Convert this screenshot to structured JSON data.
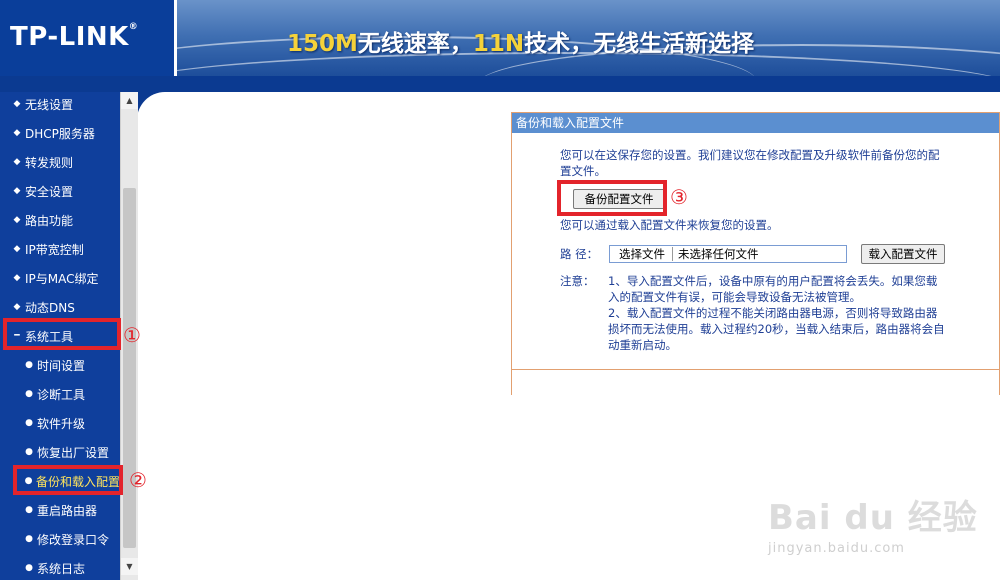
{
  "header": {
    "logo": "TP-LINK",
    "logo_mark": "®",
    "slogan_parts": [
      "150M",
      "无线速率，",
      "11N",
      "技术，无线生活新选择"
    ]
  },
  "sidebar": {
    "items": [
      {
        "label": "无线设置",
        "level": 1
      },
      {
        "label": "DHCP服务器",
        "level": 1
      },
      {
        "label": "转发规则",
        "level": 1
      },
      {
        "label": "安全设置",
        "level": 1
      },
      {
        "label": "路由功能",
        "level": 1
      },
      {
        "label": "IP带宽控制",
        "level": 1
      },
      {
        "label": "IP与MAC绑定",
        "level": 1
      },
      {
        "label": "动态DNS",
        "level": 1
      },
      {
        "label": "系统工具",
        "level": 1,
        "expanded": true
      },
      {
        "label": "时间设置",
        "level": 2
      },
      {
        "label": "诊断工具",
        "level": 2
      },
      {
        "label": "软件升级",
        "level": 2
      },
      {
        "label": "恢复出厂设置",
        "level": 2
      },
      {
        "label": "备份和载入配置",
        "level": 2,
        "active": true
      },
      {
        "label": "重启路由器",
        "level": 2
      },
      {
        "label": "修改登录口令",
        "level": 2
      },
      {
        "label": "系统日志",
        "level": 2
      }
    ]
  },
  "annotations": {
    "step1": "①",
    "step2": "②",
    "step3": "③"
  },
  "panel": {
    "title": "备份和载入配置文件",
    "backup_desc_line1": "您可以在这保存您的设置。我们建议您在修改配置及升级软件前备份您的配",
    "backup_desc_line2": "置文件。",
    "backup_button": "备份配置文件",
    "restore_desc": "您可以通过载入配置文件来恢复您的设置。",
    "path_label": "路  径：",
    "choose_file_button": "选择文件",
    "no_file_text": "未选择任何文件",
    "load_button": "载入配置文件",
    "note_label": "注意：",
    "note_lines": [
      "1、导入配置文件后，设备中原有的用户配置将会丢失。如果您载",
      "入的配置文件有误，可能会导致设备无法被管理。",
      "2、载入配置文件的过程不能关闭路由器电源，否则将导致路由器",
      "损坏而无法使用。载入过程约20秒，当载入结束后，路由器将会自",
      "动重新启动。"
    ]
  },
  "watermark": {
    "main": "Bai du 经验",
    "sub": "jingyan.baidu.com"
  },
  "colors": {
    "brand_blue": "#0b3a91",
    "sidebar_blue": "#0f3f9c",
    "panel_title": "#5b8fd0",
    "highlight_red": "#e3242b",
    "active_text": "#ffe45c",
    "slogan_highlight": "#f5d23a"
  }
}
